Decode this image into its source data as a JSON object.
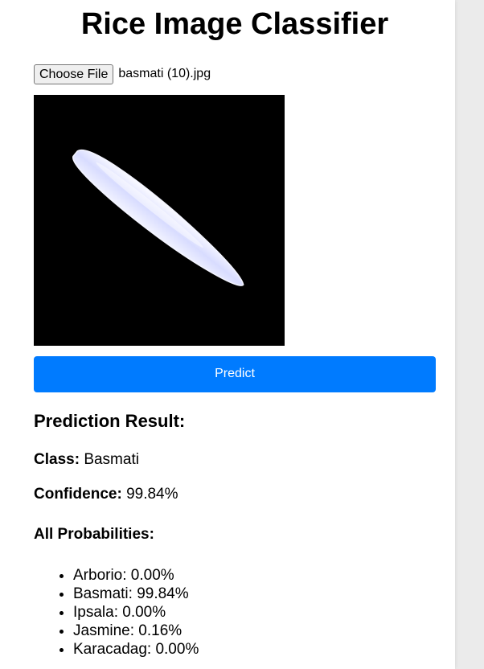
{
  "page": {
    "title": "Rice Image Classifier"
  },
  "upload": {
    "choose_label": "Choose File",
    "file_name": "basmati (10).jpg"
  },
  "preview": {
    "description": "rice-grain-image"
  },
  "predict_button": {
    "label": "Predict",
    "color": "#007bff"
  },
  "result": {
    "title": "Prediction Result:",
    "class_label": "Class:",
    "class_value": "Basmati",
    "confidence_label": "Confidence:",
    "confidence_value": "99.84%",
    "probabilities_title": "All Probabilities:",
    "probabilities": [
      {
        "text": "Arborio: 0.00%"
      },
      {
        "text": "Basmati: 99.84%"
      },
      {
        "text": "Ipsala: 0.00%"
      },
      {
        "text": "Jasmine: 0.16%"
      },
      {
        "text": "Karacadag: 0.00%"
      }
    ]
  }
}
